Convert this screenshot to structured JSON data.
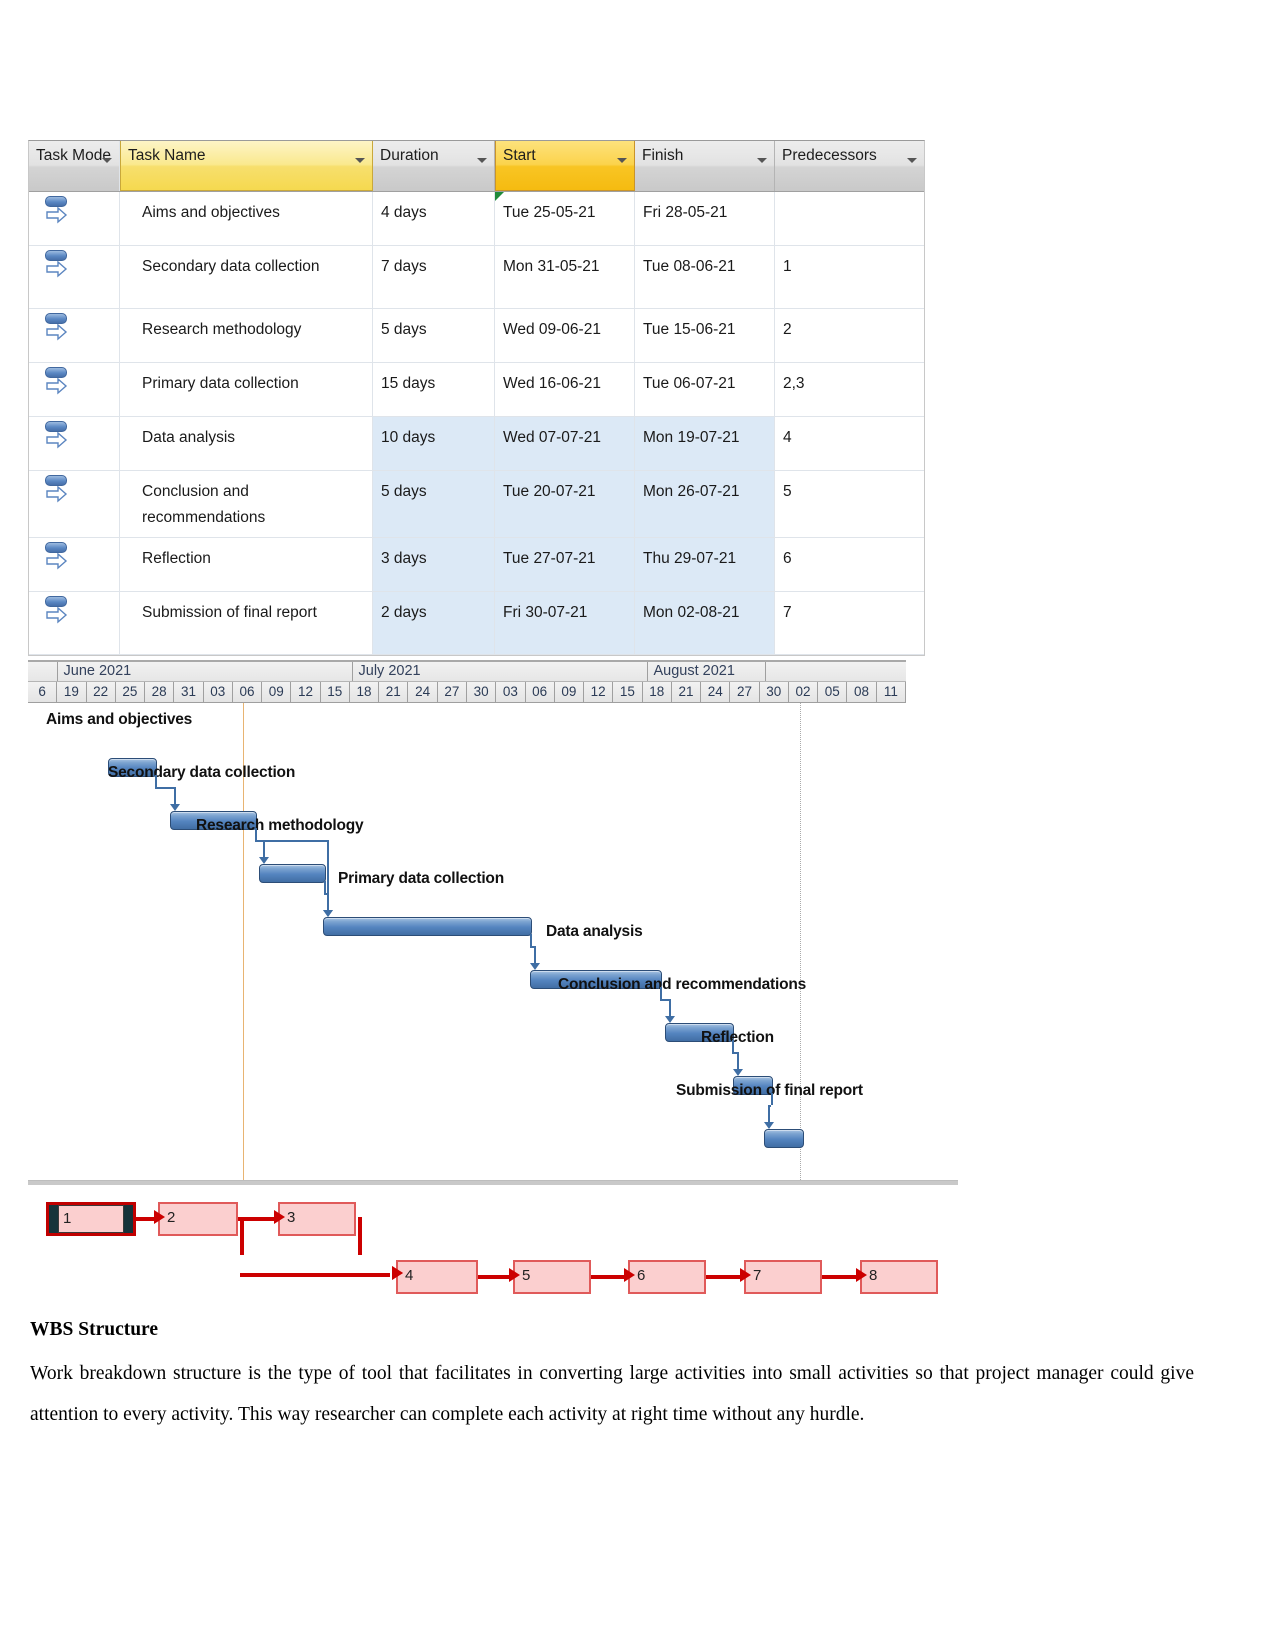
{
  "table": {
    "columns": [
      {
        "key": "task_mode",
        "label": "Task Mode",
        "style": "plain"
      },
      {
        "key": "task_name",
        "label": "Task Name",
        "style": "accent-yellow"
      },
      {
        "key": "duration",
        "label": "Duration",
        "style": "plain"
      },
      {
        "key": "start",
        "label": "Start",
        "style": "accent-gold"
      },
      {
        "key": "finish",
        "label": "Finish",
        "style": "plain"
      },
      {
        "key": "predecessors",
        "label": "Predecessors",
        "style": "plain"
      }
    ],
    "rows": [
      {
        "id": 1,
        "mode_icon": "auto-schedule-icon",
        "task_name": "Aims and objectives",
        "duration": "4 days",
        "start": "Tue 25-05-21",
        "finish": "Fri 28-05-21",
        "predecessors": "",
        "selected": false,
        "flag": true
      },
      {
        "id": 2,
        "mode_icon": "auto-schedule-icon",
        "task_name": "Secondary data collection",
        "duration": "7 days",
        "start": "Mon 31-05-21",
        "finish": "Tue 08-06-21",
        "predecessors": "1",
        "selected": false,
        "flag": false
      },
      {
        "id": 3,
        "mode_icon": "auto-schedule-icon",
        "task_name": "Research methodology",
        "duration": "5 days",
        "start": "Wed 09-06-21",
        "finish": "Tue 15-06-21",
        "predecessors": "2",
        "selected": false,
        "flag": false
      },
      {
        "id": 4,
        "mode_icon": "auto-schedule-icon",
        "task_name": "Primary data collection",
        "duration": "15 days",
        "start": "Wed 16-06-21",
        "finish": "Tue 06-07-21",
        "predecessors": "2,3",
        "selected": false,
        "flag": false
      },
      {
        "id": 5,
        "mode_icon": "auto-schedule-icon",
        "task_name": "Data analysis",
        "duration": "10 days",
        "start": "Wed 07-07-21",
        "finish": "Mon 19-07-21",
        "predecessors": "4",
        "selected": true,
        "flag": false
      },
      {
        "id": 6,
        "mode_icon": "auto-schedule-icon",
        "task_name": "Conclusion and recommendations",
        "duration": "5 days",
        "start": "Tue 20-07-21",
        "finish": "Mon 26-07-21",
        "predecessors": "5",
        "selected": true,
        "flag": false
      },
      {
        "id": 7,
        "mode_icon": "auto-schedule-icon",
        "task_name": "Reflection",
        "duration": "3 days",
        "start": "Tue 27-07-21",
        "finish": "Thu 29-07-21",
        "predecessors": "6",
        "selected": true,
        "flag": false
      },
      {
        "id": 8,
        "mode_icon": "auto-schedule-icon",
        "task_name": "Submission of final report",
        "duration": "2 days",
        "start": "Fri 30-07-21",
        "finish": "Mon 02-08-21",
        "predecessors": "7",
        "selected": true,
        "flag": false
      }
    ]
  },
  "chart_data": {
    "type": "bar",
    "title": "",
    "subtitle": "Gantt chart timeline",
    "xlabel": "",
    "ylabel": "",
    "months": [
      {
        "label": "",
        "span": 1
      },
      {
        "label": "June 2021",
        "span": 10
      },
      {
        "label": "July 2021",
        "span": 10
      },
      {
        "label": "August 2021",
        "span": 4
      }
    ],
    "day_ticks": [
      "6",
      "19",
      "22",
      "25",
      "28",
      "31",
      "03",
      "06",
      "09",
      "12",
      "15",
      "18",
      "21",
      "24",
      "27",
      "30",
      "03",
      "06",
      "09",
      "12",
      "15",
      "18",
      "21",
      "24",
      "27",
      "30",
      "02",
      "05",
      "08",
      "11"
    ],
    "tasks": [
      {
        "name": "Aims and objectives",
        "start": "Tue 25-05-21",
        "finish": "Fri 28-05-21",
        "duration_days": 4
      },
      {
        "name": "Secondary data collection",
        "start": "Mon 31-05-21",
        "finish": "Tue 08-06-21",
        "duration_days": 7
      },
      {
        "name": "Research methodology",
        "start": "Wed 09-06-21",
        "finish": "Tue 15-06-21",
        "duration_days": 5
      },
      {
        "name": "Primary data collection",
        "start": "Wed 16-06-21",
        "finish": "Tue 06-07-21",
        "duration_days": 15
      },
      {
        "name": "Data analysis",
        "start": "Wed 07-07-21",
        "finish": "Mon 19-07-21",
        "duration_days": 10
      },
      {
        "name": "Conclusion and recommendations",
        "start": "Tue 20-07-21",
        "finish": "Mon 26-07-21",
        "duration_days": 5
      },
      {
        "name": "Reflection",
        "start": "Tue 27-07-21",
        "finish": "Thu 29-07-21",
        "duration_days": 3
      },
      {
        "name": "Submission of final report",
        "start": "Fri 30-07-21",
        "finish": "Mon 02-08-21",
        "duration_days": 2
      }
    ],
    "grid": false,
    "legend": "none"
  },
  "network": {
    "nodes": [
      {
        "id": "1",
        "label": "1",
        "selected": true
      },
      {
        "id": "2",
        "label": "2",
        "selected": false
      },
      {
        "id": "3",
        "label": "3",
        "selected": false
      },
      {
        "id": "4",
        "label": "4",
        "selected": false
      },
      {
        "id": "5",
        "label": "5",
        "selected": false
      },
      {
        "id": "6",
        "label": "6",
        "selected": false
      },
      {
        "id": "7",
        "label": "7",
        "selected": false
      },
      {
        "id": "8",
        "label": "8",
        "selected": false
      }
    ],
    "edges": [
      {
        "from": "1",
        "to": "2"
      },
      {
        "from": "2",
        "to": "3"
      },
      {
        "from": "2",
        "to": "4"
      },
      {
        "from": "3",
        "to": "4"
      },
      {
        "from": "4",
        "to": "5"
      },
      {
        "from": "5",
        "to": "6"
      },
      {
        "from": "6",
        "to": "7"
      },
      {
        "from": "7",
        "to": "8"
      }
    ],
    "link_color": "#cc0000",
    "node_fill": "#fbcfcf",
    "node_border": "#e05a5a"
  },
  "prose": {
    "heading": "WBS Structure",
    "body": "Work breakdown structure is the type of tool that facilitates in converting large activities into small activities so that project manager could give attention to every activity. This way researcher can complete each activity at right time without any hurdle."
  }
}
